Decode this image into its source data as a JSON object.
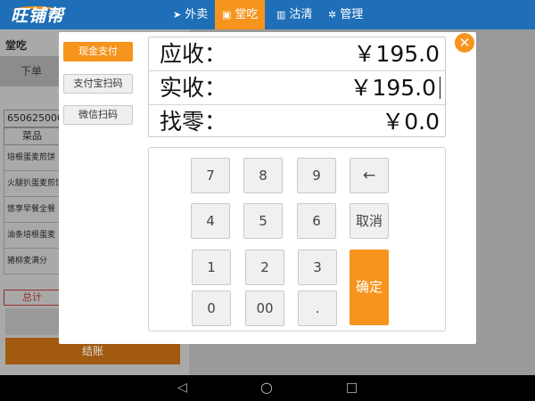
{
  "app": {
    "logo_text": "旺铺帮",
    "nav": [
      {
        "icon": "send-icon",
        "glyph": "➤",
        "label": "外卖"
      },
      {
        "icon": "dine-icon",
        "glyph": "▣",
        "label": "堂吃"
      },
      {
        "icon": "chart-icon",
        "glyph": "▥",
        "label": "沽清"
      },
      {
        "icon": "gear-icon",
        "glyph": "✲",
        "label": "管理"
      }
    ],
    "active_nav": "堂吃"
  },
  "background": {
    "section_title": "堂吃",
    "order_button": "下单",
    "order_id": "650625000",
    "dish_header": "菜品",
    "dishes": [
      "培根蛋麦煎饼",
      "火腿扒蛋麦煎饼",
      "悠享早餐全餐",
      "油条培根蛋麦",
      "猪柳麦满分"
    ],
    "total_label": "总计",
    "checkout_button": "结账"
  },
  "modal": {
    "payment_methods": [
      "现金支付",
      "支付宝扫码",
      "微信扫码"
    ],
    "active_method": "现金支付",
    "amounts": [
      {
        "label": "应收：",
        "value": "￥195.0"
      },
      {
        "label": "实收：",
        "value": "￥195.0"
      },
      {
        "label": "找零：",
        "value": "￥0.0"
      }
    ],
    "keys": {
      "k7": "7",
      "k8": "8",
      "k9": "9",
      "back": "←",
      "k4": "4",
      "k5": "5",
      "k6": "6",
      "cancel": "取消",
      "k1": "1",
      "k2": "2",
      "k3": "3",
      "k0": "0",
      "k00": "00",
      "dot": ".",
      "ok": "确定"
    },
    "close_glyph": "✕"
  },
  "android_nav": {
    "back": "◁",
    "home": "○",
    "recents": "□"
  },
  "colors": {
    "brand_blue": "#1e6fb8",
    "accent_orange": "#f7941d"
  }
}
